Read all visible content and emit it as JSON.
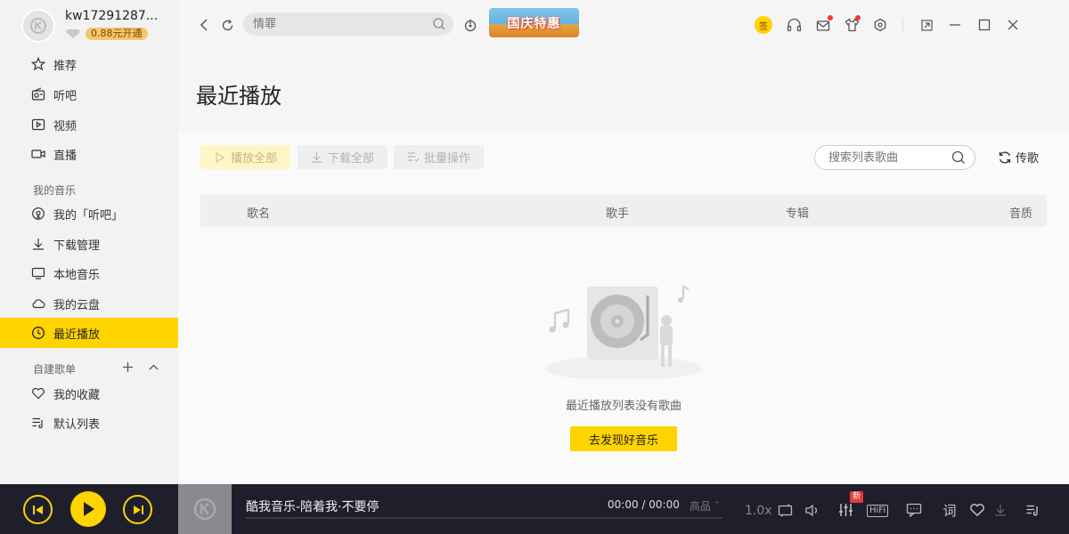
{
  "user": {
    "name": "kw17291287...",
    "vip_text": "0.88元开通"
  },
  "sidebar": {
    "items": [
      {
        "label": "推荐",
        "icon": "star-icon"
      },
      {
        "label": "听吧",
        "icon": "radio-icon"
      },
      {
        "label": "视频",
        "icon": "video-icon"
      },
      {
        "label": "直播",
        "icon": "live-camera-icon"
      }
    ],
    "my_music_label": "我的音乐",
    "my_items": [
      {
        "label": "我的「听吧」",
        "icon": "podcast-icon"
      },
      {
        "label": "下载管理",
        "icon": "download-icon"
      },
      {
        "label": "本地音乐",
        "icon": "monitor-icon"
      },
      {
        "label": "我的云盘",
        "icon": "cloud-icon"
      },
      {
        "label": "最近播放",
        "icon": "clock-icon",
        "active": true
      }
    ],
    "playlist_label": "自建歌单",
    "playlists": [
      {
        "label": "我的收藏",
        "icon": "heart-icon"
      },
      {
        "label": "默认列表",
        "icon": "playlist-icon"
      }
    ]
  },
  "topbar": {
    "search_placeholder": "情罪",
    "promo_text": "国庆特惠",
    "sign_text": "签"
  },
  "main": {
    "title": "最近播放",
    "buttons": {
      "play_all": "播放全部",
      "download_all": "下载全部",
      "batch": "批量操作"
    },
    "list_search_placeholder": "搜索列表歌曲",
    "share_label": "传歌",
    "columns": [
      "歌名",
      "歌手",
      "专辑",
      "音质"
    ],
    "empty_text": "最近播放列表没有歌曲",
    "discover_label": "去发现好音乐"
  },
  "player": {
    "song": "酷我音乐-陪着我·不要停",
    "time": "00:00 / 00:00",
    "quality": "高品 ˆ",
    "speed": "1.0x",
    "new_badge": "新",
    "hifi": "HiFi",
    "lyric_label": "词",
    "accent": "#ffd400"
  }
}
